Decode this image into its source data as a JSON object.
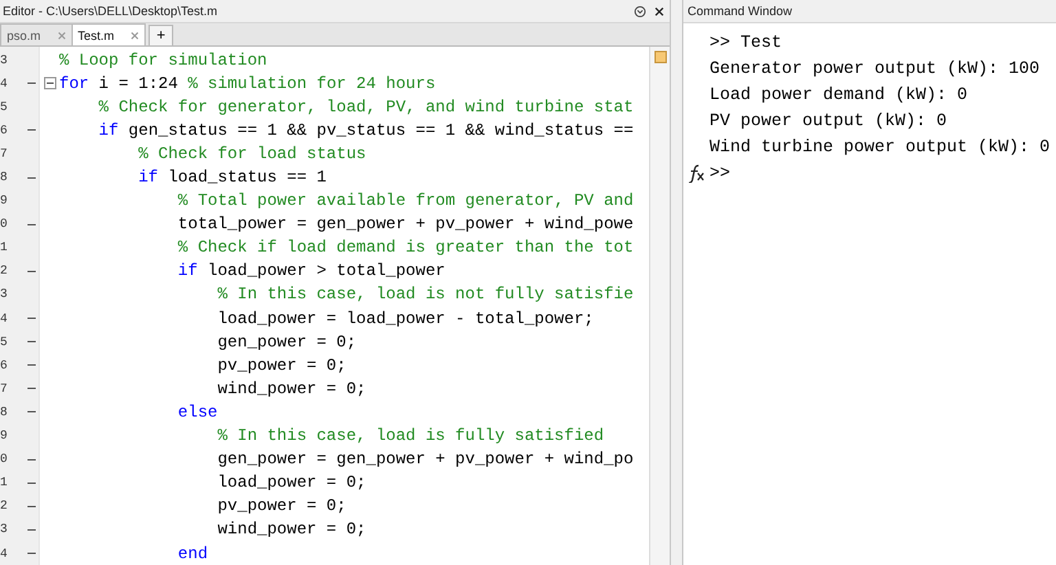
{
  "editor": {
    "title": "Editor - C:\\Users\\DELL\\Desktop\\Test.m",
    "tabs": [
      {
        "label": "pso.m",
        "selected": false
      },
      {
        "label": "Test.m",
        "selected": true
      }
    ],
    "new_tab": "+",
    "lines": [
      {
        "number": "3",
        "executable": false,
        "fold": false,
        "segments": [
          {
            "kind": "comment",
            "text": "% Loop for simulation"
          }
        ]
      },
      {
        "number": "4",
        "executable": true,
        "fold": true,
        "segments": [
          {
            "kind": "keyword",
            "text": "for"
          },
          {
            "kind": "code",
            "text": " i = 1:24 "
          },
          {
            "kind": "comment",
            "text": "% simulation for 24 hours"
          }
        ]
      },
      {
        "number": "5",
        "executable": false,
        "fold": false,
        "segments": [
          {
            "kind": "comment",
            "text": "    % Check for generator, load, PV, and wind turbine stat"
          }
        ]
      },
      {
        "number": "6",
        "executable": true,
        "fold": false,
        "segments": [
          {
            "kind": "keyword",
            "text": "    if"
          },
          {
            "kind": "code",
            "text": " gen_status == 1 && pv_status == 1 && wind_status =="
          }
        ]
      },
      {
        "number": "7",
        "executable": false,
        "fold": false,
        "segments": [
          {
            "kind": "comment",
            "text": "        % Check for load status"
          }
        ]
      },
      {
        "number": "8",
        "executable": true,
        "fold": false,
        "segments": [
          {
            "kind": "keyword",
            "text": "        if"
          },
          {
            "kind": "code",
            "text": " load_status == 1"
          }
        ]
      },
      {
        "number": "9",
        "executable": false,
        "fold": false,
        "segments": [
          {
            "kind": "comment",
            "text": "            % Total power available from generator, PV and"
          }
        ]
      },
      {
        "number": "0",
        "executable": true,
        "fold": false,
        "segments": [
          {
            "kind": "code",
            "text": "            total_power = gen_power + pv_power + wind_powe"
          }
        ]
      },
      {
        "number": "1",
        "executable": false,
        "fold": false,
        "segments": [
          {
            "kind": "comment",
            "text": "            % Check if load demand is greater than the tot"
          }
        ]
      },
      {
        "number": "2",
        "executable": true,
        "fold": false,
        "segments": [
          {
            "kind": "keyword",
            "text": "            if"
          },
          {
            "kind": "code",
            "text": " load_power > total_power"
          }
        ]
      },
      {
        "number": "3",
        "executable": false,
        "fold": false,
        "segments": [
          {
            "kind": "comment",
            "text": "                % In this case, load is not fully satisfie"
          }
        ]
      },
      {
        "number": "4",
        "executable": true,
        "fold": false,
        "segments": [
          {
            "kind": "code",
            "text": "                load_power = load_power - total_power;"
          }
        ]
      },
      {
        "number": "5",
        "executable": true,
        "fold": false,
        "segments": [
          {
            "kind": "code",
            "text": "                gen_power = 0;"
          }
        ]
      },
      {
        "number": "6",
        "executable": true,
        "fold": false,
        "segments": [
          {
            "kind": "code",
            "text": "                pv_power = 0;"
          }
        ]
      },
      {
        "number": "7",
        "executable": true,
        "fold": false,
        "segments": [
          {
            "kind": "code",
            "text": "                wind_power = 0;"
          }
        ]
      },
      {
        "number": "8",
        "executable": true,
        "fold": false,
        "segments": [
          {
            "kind": "keyword",
            "text": "            else"
          }
        ]
      },
      {
        "number": "9",
        "executable": false,
        "fold": false,
        "segments": [
          {
            "kind": "comment",
            "text": "                % In this case, load is fully satisfied"
          }
        ]
      },
      {
        "number": "0",
        "executable": true,
        "fold": false,
        "segments": [
          {
            "kind": "code",
            "text": "                gen_power = gen_power + pv_power + wind_po"
          }
        ]
      },
      {
        "number": "1",
        "executable": true,
        "fold": false,
        "segments": [
          {
            "kind": "code",
            "text": "                load_power = 0;"
          }
        ]
      },
      {
        "number": "2",
        "executable": true,
        "fold": false,
        "segments": [
          {
            "kind": "code",
            "text": "                pv_power = 0;"
          }
        ]
      },
      {
        "number": "3",
        "executable": true,
        "fold": false,
        "segments": [
          {
            "kind": "code",
            "text": "                wind_power = 0;"
          }
        ]
      },
      {
        "number": "4",
        "executable": true,
        "fold": false,
        "segments": [
          {
            "kind": "keyword",
            "text": "            end"
          }
        ]
      }
    ]
  },
  "command_window": {
    "title": "Command Window",
    "lines": [
      ">> Test",
      "Generator power output (kW): 100",
      "Load power demand (kW): 0",
      "PV power output (kW): 0",
      "Wind turbine power output (kW): 0"
    ],
    "prompt": ">>"
  }
}
